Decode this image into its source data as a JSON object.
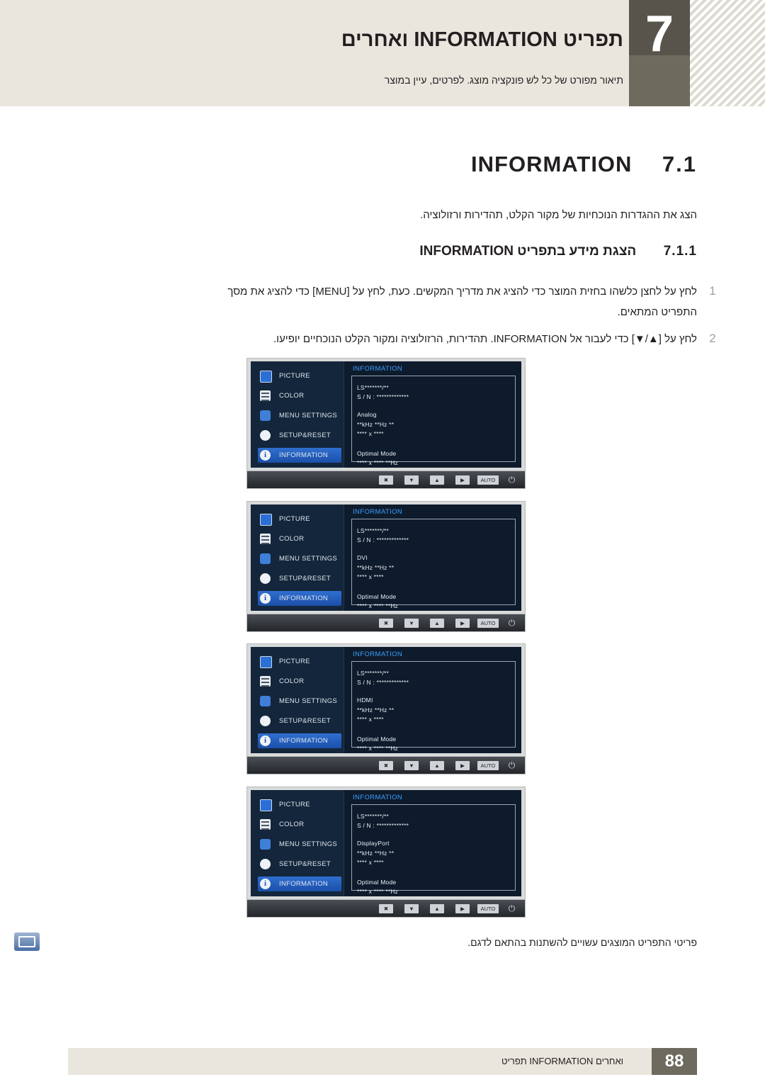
{
  "header": {
    "chapter_number": "7",
    "title": "תפריט INFORMATION ואחרים",
    "subtitle": "תיאור מפורט של כל לש פונקציה מוצג. לפרטים, עיין במוצר"
  },
  "section": {
    "number": "7.1",
    "name": "INFORMATION",
    "intro": "הצג את ההגדרות הנוכחיות של מקור הקלט, תהדירות ורזולוציה."
  },
  "subsection": {
    "number": "7.1.1",
    "name": "הצגת מידע בתפריט INFORMATION"
  },
  "steps": [
    {
      "num": "1",
      "line1": "לחץ על לחצן כלשהו בחזית המוצר כדי להציג את מדריך המקשים. כעת, לחץ על [MENU] כדי להציג את מסך",
      "line2": "התפריט המתאים."
    },
    {
      "num": "2",
      "line1": "לחץ על [▲/▼] כדי לעבור אל INFORMATION. תהדירות, הרזולוציה ומקור הקלט הנוכחיים יופיעו."
    }
  ],
  "osd_menu_items": [
    "PICTURE",
    "COLOR",
    "MENU SETTINGS",
    "SETUP&RESET",
    "INFORMATION"
  ],
  "osd_selected": "INFORMATION",
  "osd_title": "INFORMATION",
  "osd_buttons": [
    "✖",
    "▼",
    "▲",
    "▶",
    "AUTO"
  ],
  "osd_power_glyph": "⏻",
  "osd_panels": [
    {
      "lines": [
        "LS*******/**",
        "S / N : *************",
        "Analog",
        "**kHz **Hz **",
        "**** x ****",
        "Optimal Mode",
        "**** x **** **Hz"
      ],
      "source": "Analog"
    },
    {
      "lines": [
        "LS*******/**",
        "S / N : *************",
        "DVI",
        "**kHz **Hz **",
        "**** x ****",
        "Optimal Mode",
        "**** x **** **Hz"
      ],
      "source": "DVI"
    },
    {
      "lines": [
        "LS*******/**",
        "S / N : *************",
        "HDMI",
        "**kHz **Hz **",
        "**** x ****",
        "Optimal Mode",
        "**** x **** **Hz"
      ],
      "source": "HDMI"
    },
    {
      "lines": [
        "LS*******/**",
        "S / N : *************",
        "DisplayPort",
        "**kHz **Hz **",
        "**** x ****",
        "Optimal Mode",
        "**** x **** **Hz"
      ],
      "source": "DisplayPort"
    }
  ],
  "note": "פריטי התפריט המוצגים עשויים להשתנות בהתאם לדגם.",
  "footer": {
    "page_number": "88",
    "text": "ואחרים INFORMATION תפריט"
  },
  "colors": {
    "accent": "#2f6fd0",
    "band": "#e9e6de",
    "dark": "#6f6a5e",
    "osd_title": "#3da0ff"
  }
}
